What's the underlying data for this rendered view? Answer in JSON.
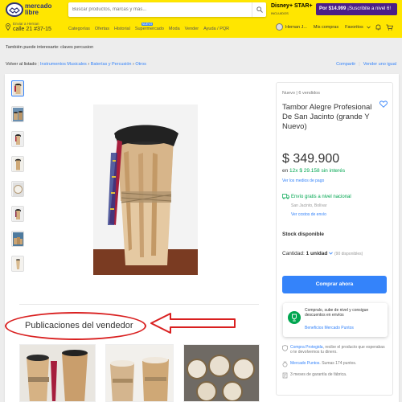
{
  "header": {
    "logo_line1": "mercado",
    "logo_line2": "libre",
    "search_placeholder": "Buscar productos, marcas y más...",
    "promo_brand": "Disney+ STAR+",
    "promo_sub": "INCLUIDOS",
    "promo_price": "Por $14.999",
    "promo_cta": "¡Suscribite a nivel 6!",
    "location_label": "Enviar a Hernan",
    "location_value": "calle 21 #37-15",
    "nav": [
      "Categorías",
      "Ofertas",
      "Historial",
      "Supermercado",
      "Moda",
      "Vender",
      "Ayuda / PQR"
    ],
    "nav_new_badge": "NUEVO",
    "user_name": "Hernan J...",
    "user_links": [
      "Mis compras",
      "Favoritos"
    ]
  },
  "related_searches": "También puede interesarte: claves percusion",
  "breadcrumb": {
    "back": "Volver al listado",
    "items": [
      "Instrumentos Musicales",
      "Baterías y Percusión",
      "Otros"
    ],
    "share": "Compartir",
    "sell_same": "Vender uno igual"
  },
  "thumbnails": [
    "thumb-1",
    "thumb-2",
    "thumb-3",
    "thumb-4",
    "thumb-5",
    "thumb-6",
    "thumb-7",
    "thumb-8"
  ],
  "seller_publications_title": "Publicaciones del vendedor",
  "product": {
    "condition": "Nuevo | 6 vendidos",
    "title": "Tambor Alegre Profesional De San Jacinto (grande Y Nuevo)",
    "price": "$ 349.900",
    "installments_prefix": "en",
    "installments_value": "12x $ 29.158 sin interés",
    "payment_link": "Ver los medios de pago",
    "shipping": "Envío gratis a nivel nacional",
    "shipping_from": "San Jacinto, Bolívar",
    "shipping_link": "Ver costos de envío",
    "stock": "Stock disponible",
    "quantity_label": "Cantidad:",
    "quantity_value": "1 unidad",
    "quantity_available": "(90 disponibles)",
    "buy_button": "Comprar ahora"
  },
  "level_promo": {
    "text": "Compralo, sube de nivel y consigue descuentos en envíos",
    "link": "Beneficios Mercado Puntos"
  },
  "benefits": [
    {
      "link": "Compra Protegida",
      "text": ", recibe el producto que esperabas o te devolvemos tu dinero."
    },
    {
      "link": "Mercado Puntos",
      "text": ". Sumas 174 puntos."
    },
    {
      "link": "",
      "text": "3 meses de garantía de fábrica."
    }
  ],
  "colors": {
    "header_bg": "#ffe600",
    "accent": "#3483fa",
    "success": "#00a650",
    "annotation": "#d92020",
    "promo": "#4b1e87"
  }
}
